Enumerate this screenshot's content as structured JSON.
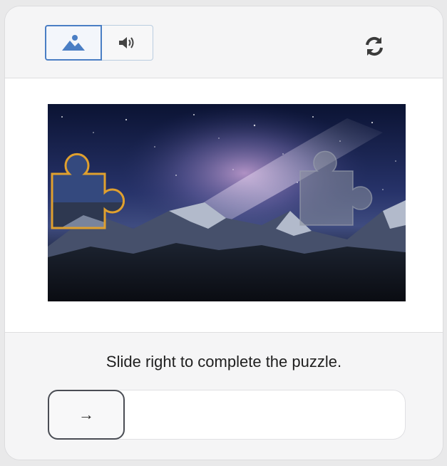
{
  "header": {
    "modes": [
      {
        "name": "image",
        "icon": "image-icon",
        "selected": true
      },
      {
        "name": "audio",
        "icon": "speaker-icon",
        "selected": false
      }
    ],
    "refresh_icon": "refresh-icon"
  },
  "puzzle": {
    "image_icon": "puzzle-image",
    "piece_icon": "puzzle-piece-icon",
    "slot_icon": "puzzle-slot-icon"
  },
  "footer": {
    "instruction": "Slide right to complete the puzzle.",
    "slider": {
      "handle_symbol": "→",
      "position": 0
    }
  },
  "colors": {
    "accent": "#4a7ec4",
    "piece_border": "#e0a02e",
    "handle_border": "#4a4d54"
  }
}
